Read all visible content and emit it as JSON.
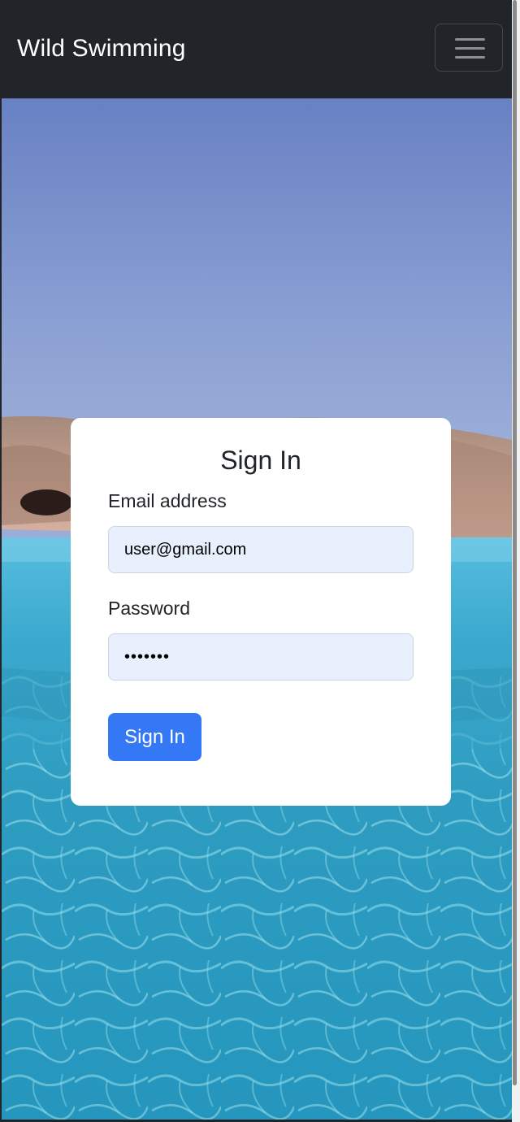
{
  "navbar": {
    "brand": "Wild Swimming",
    "toggler_icon": "hamburger-menu-icon"
  },
  "background": {
    "subject": "sea-photo",
    "colors": {
      "sky": "#8197cf",
      "rocks": "#b89a86",
      "sea": "#4fb3d0"
    }
  },
  "login": {
    "title": "Sign In",
    "email_label": "Email address",
    "email_value": "user@gmail.com",
    "password_label": "Password",
    "password_value": "•••••••",
    "submit_label": "Sign In"
  },
  "colors": {
    "navbar": "#212529",
    "primary": "#3578f5",
    "autofill": "#e8f0fe"
  }
}
